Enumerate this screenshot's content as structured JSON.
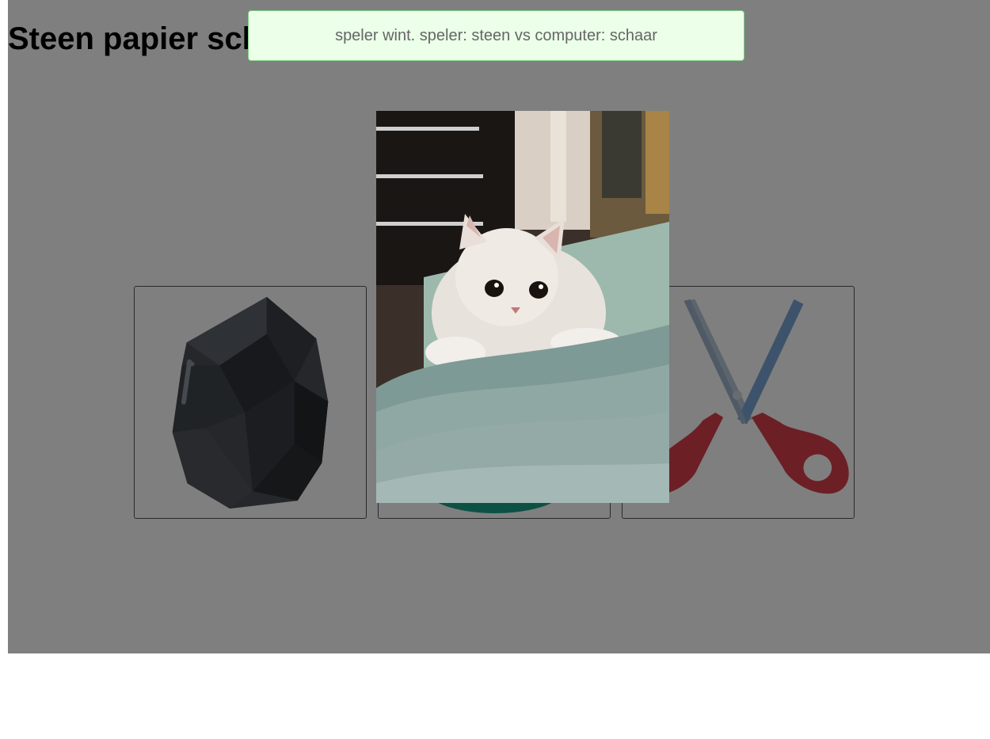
{
  "page": {
    "title": "Steen papier schaar"
  },
  "choices": [
    {
      "id": "steen",
      "icon": "rock-icon"
    },
    {
      "id": "papier",
      "icon": "paper-icon"
    },
    {
      "id": "schaar",
      "icon": "scissors-icon"
    }
  ],
  "result": {
    "message": "speler wint. speler: steen vs computer: schaar"
  },
  "popup": {
    "image": "kitten-photo"
  },
  "colors": {
    "overlay": "#808080",
    "toast_bg": "#ebffe9",
    "toast_border": "#7fcf86"
  }
}
